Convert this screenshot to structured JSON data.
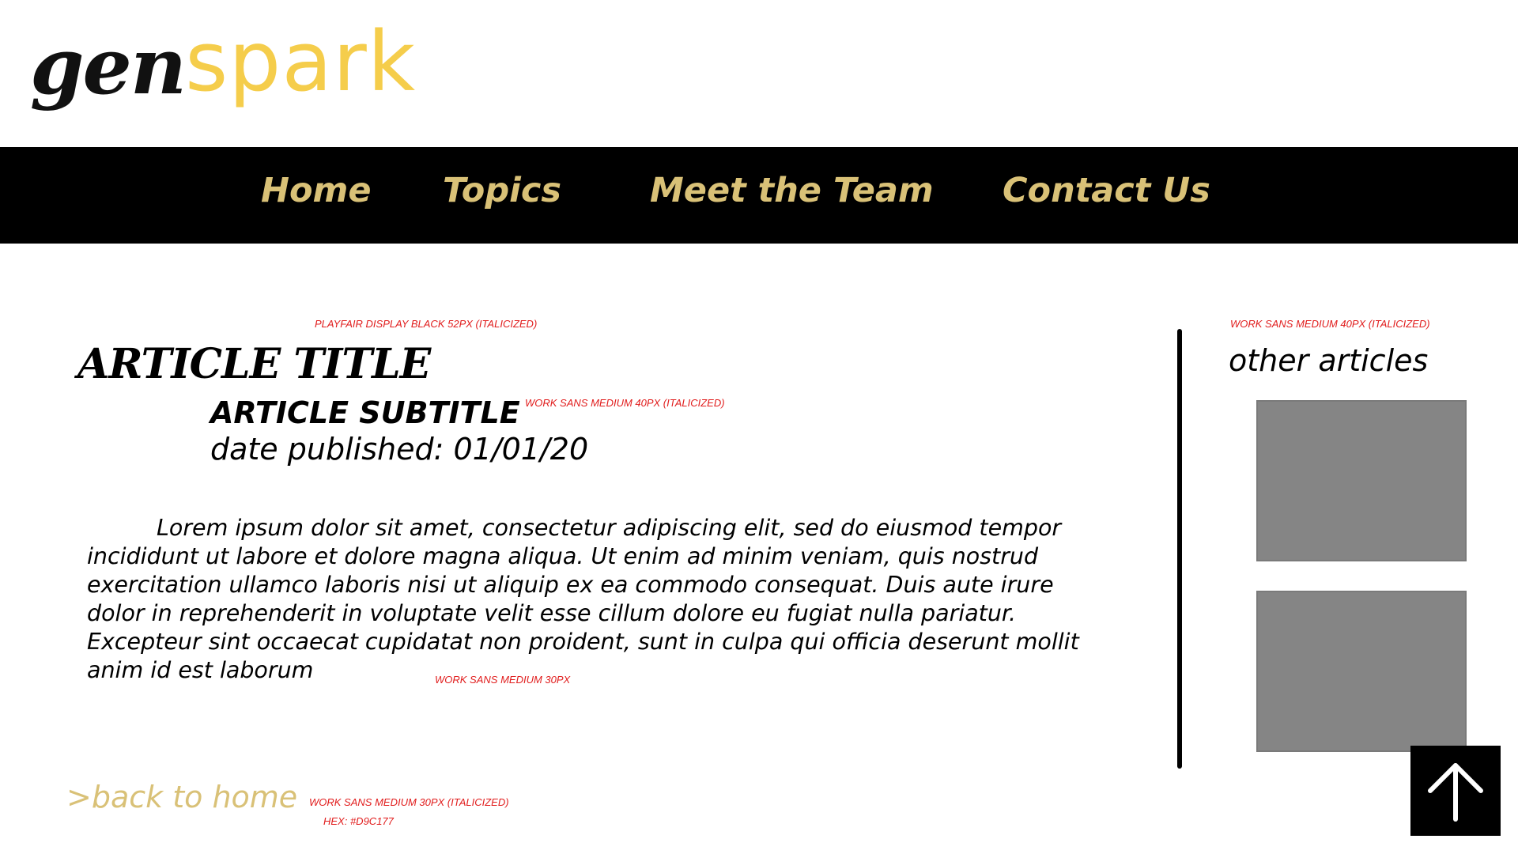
{
  "logo": {
    "part1": "gen",
    "part2": "spark"
  },
  "nav": {
    "items": [
      {
        "label": "Home"
      },
      {
        "label": "Topics"
      },
      {
        "label": "Meet the Team"
      },
      {
        "label": "Contact Us"
      }
    ]
  },
  "article": {
    "title": "ARTICLE TITLE",
    "subtitle": "ARTICLE SUBTITLE",
    "date": "date published: 01/01/20",
    "body": "Lorem ipsum dolor sit amet, consectetur adipiscing elit, sed do eiusmod tempor incididunt ut labore et dolore magna aliqua. Ut enim ad minim veniam, quis nostrud exercitation ullamco laboris nisi ut aliquip ex ea commodo consequat. Duis aute irure dolor in reprehenderit in voluptate velit esse cillum dolore eu fugiat nulla pariatur. Excepteur sint occaecat cupidatat non proident, sunt in culpa qui officia deserunt mollit anim id est laborum",
    "back_link": ">back to home"
  },
  "sidebar": {
    "heading": "other articles"
  },
  "annotations": {
    "title_note": "PLAYFAIR DISPLAY BLACK 52PX (ITALICIZED)",
    "subtitle_note": "WORK SANS MEDIUM 40PX (ITALICIZED)",
    "body_note": "WORK SANS MEDIUM 30PX",
    "back_note": "WORK SANS MEDIUM 30PX (ITALICIZED)",
    "back_hex_note": "HEX: #D9C177",
    "sidebar_note": "WORK SANS MEDIUM 40PX (ITALICIZED)"
  },
  "icons": {
    "scroll_top": "arrow-up-icon"
  },
  "colors": {
    "accent_gold": "#D9C177",
    "logo_yellow": "#F5CD4B",
    "nav_background": "#000000",
    "annotation_red": "#E11D1D",
    "thumbnail_gray": "#858585"
  }
}
